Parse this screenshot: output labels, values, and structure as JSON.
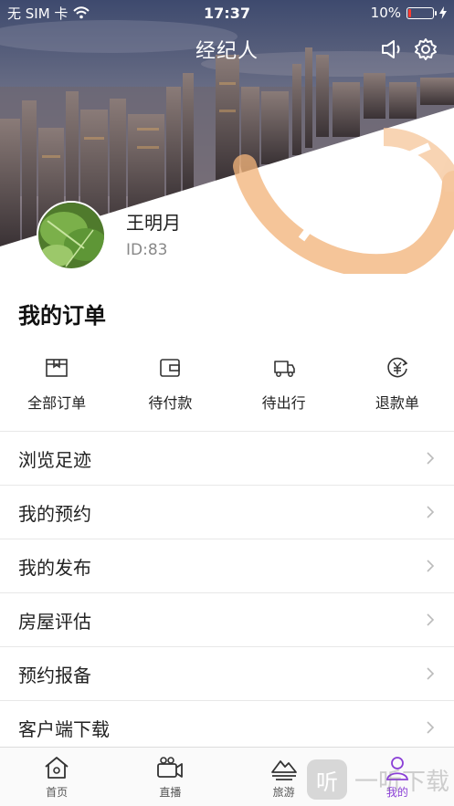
{
  "status_bar": {
    "carrier": "无 SIM 卡",
    "time": "17:37",
    "battery_text": "10%",
    "battery_level": 0.1
  },
  "header": {
    "title": "经纪人",
    "speaker_icon": "speaker-icon",
    "settings_icon": "gear-icon"
  },
  "profile": {
    "name": "王明月",
    "id_text": "ID:83"
  },
  "orders": {
    "title": "我的订单",
    "items": [
      {
        "label": "全部订单",
        "icon": "box-icon"
      },
      {
        "label": "待付款",
        "icon": "wallet-icon"
      },
      {
        "label": "待出行",
        "icon": "truck-icon"
      },
      {
        "label": "退款单",
        "icon": "yuan-refund-icon"
      }
    ]
  },
  "menu": {
    "items": [
      {
        "label": "浏览足迹"
      },
      {
        "label": "我的预约"
      },
      {
        "label": "我的发布"
      },
      {
        "label": "房屋评估"
      },
      {
        "label": "预约报备"
      },
      {
        "label": "客户端下载"
      }
    ]
  },
  "tabbar": {
    "items": [
      {
        "label": "首页",
        "icon": "home-icon"
      },
      {
        "label": "直播",
        "icon": "video-camera-icon"
      },
      {
        "label": "旅游",
        "icon": "mountain-icon"
      },
      {
        "label": "我的",
        "icon": "person-icon",
        "active": true
      }
    ]
  },
  "watermark": {
    "logo_char": "听",
    "text": "一听下载"
  },
  "colors": {
    "accent": "#8a3fd6",
    "brand_orange": "#f0a868",
    "battery_low": "#ff3b30"
  }
}
